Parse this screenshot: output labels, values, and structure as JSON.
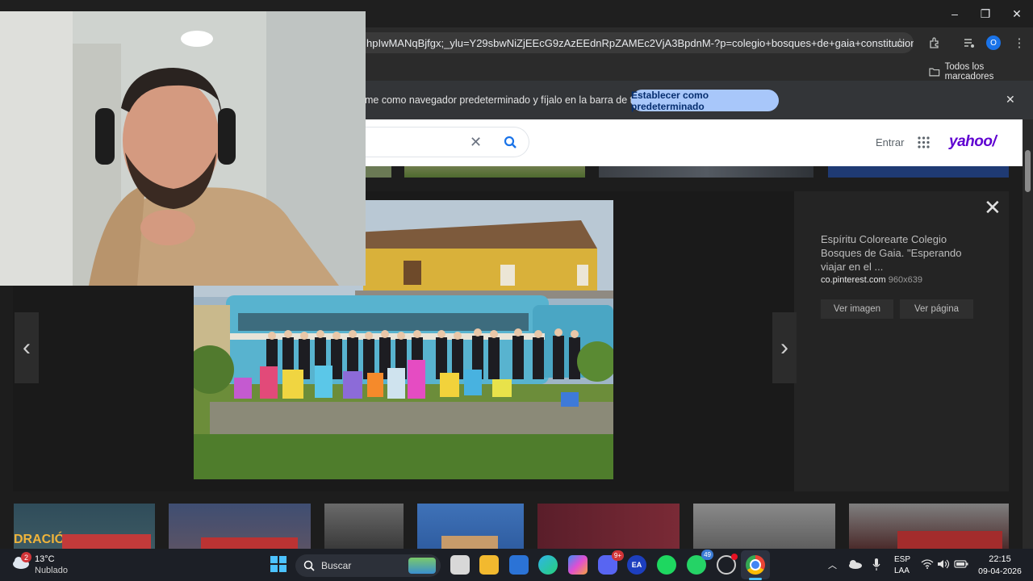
{
  "browser": {
    "url": "hpIwMANqBjfgx;_ylu=Y29sbwNiZjEEcG9zAzEEdnRpZAMEc2VjA3BpdnM-?p=colegio+bosques+de+gaia+constitucion&fr2=...",
    "bookmarks_label": "Todos los marcadores",
    "profile_initial": "O",
    "infobar_text": "me como navegador predeterminado y fíjalo en la barra de tareas",
    "infobar_button": "Establecer como predeterminado",
    "minimize": "–",
    "restore": "❐",
    "close": "✕"
  },
  "yahoo": {
    "signin": "Entrar",
    "logo": "yahoo/",
    "accent": "#5f01d1"
  },
  "viewer": {
    "title": "Espíritu Colorearte Colegio Bosques de Gaia. \"Esperando viajar en el ...",
    "source": "co.pinterest.com",
    "dimensions": "960x639",
    "view_image": "Ver imagen",
    "view_page": "Ver página"
  },
  "thumbnails_text": {
    "first_caption": "DRACIÓ"
  },
  "taskbar": {
    "weather_badge": "2",
    "temperature": "13°C",
    "weather_desc": "Nublado",
    "search_placeholder": "Buscar",
    "discord_badge": "9+",
    "whatsapp_badge": "49",
    "lang_1": "ESP",
    "lang_2": "LAA",
    "time": "22:15",
    "date": "09-04-2026"
  }
}
